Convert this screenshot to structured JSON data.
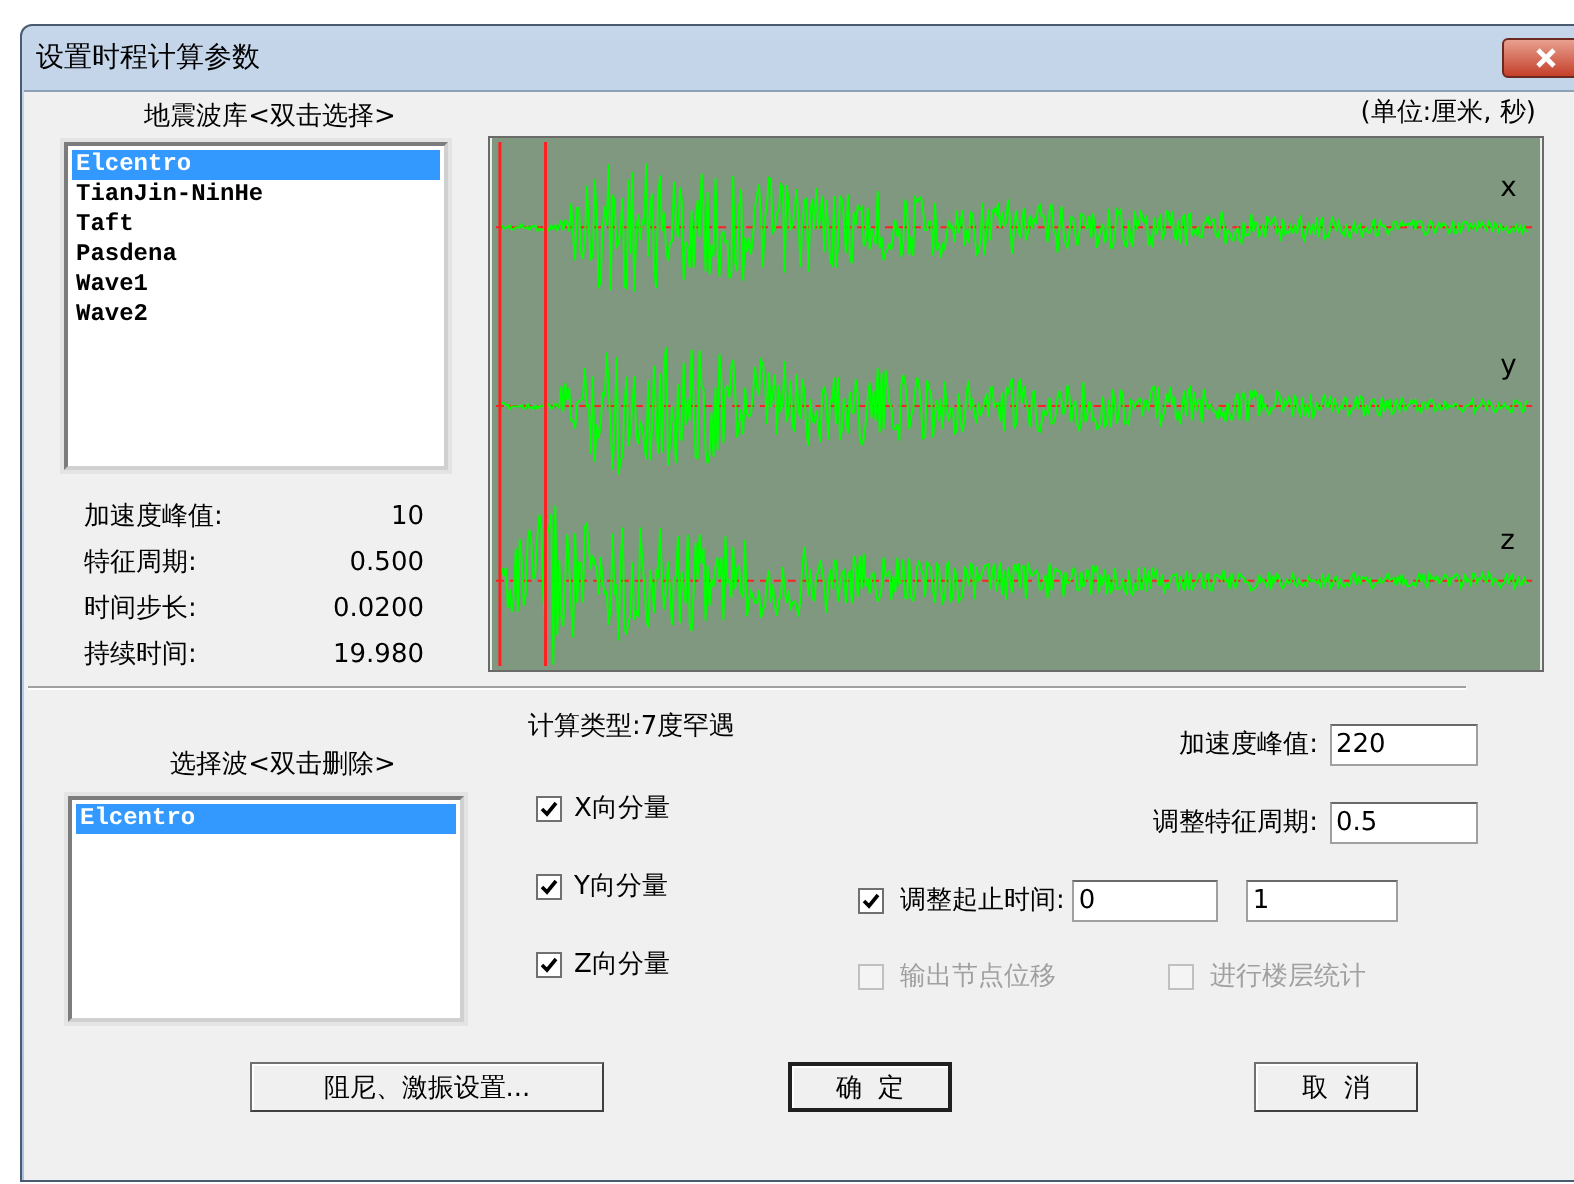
{
  "window": {
    "title": "设置时程计算参数"
  },
  "library": {
    "title": "地震波库<双击选择>",
    "items": [
      {
        "label": "Elcentro",
        "selected": true
      },
      {
        "label": "TianJin-NinHe",
        "selected": false
      },
      {
        "label": "Taft",
        "selected": false
      },
      {
        "label": "Pasdena",
        "selected": false
      },
      {
        "label": "Wave1",
        "selected": false
      },
      {
        "label": "Wave2",
        "selected": false
      }
    ]
  },
  "wave_info": [
    {
      "label": "加速度峰值:",
      "value": "10"
    },
    {
      "label": "特征周期:",
      "value": "0.500"
    },
    {
      "label": "时间步长:",
      "value": "0.0200"
    },
    {
      "label": "持续时间:",
      "value": "19.980"
    }
  ],
  "units": "(单位:厘米, 秒)",
  "plot": {
    "traces": [
      {
        "label": "x"
      },
      {
        "label": "y"
      },
      {
        "label": "z"
      }
    ]
  },
  "selected_waves": {
    "title": "选择波<双击删除>",
    "items": [
      {
        "label": "Elcentro",
        "selected": true
      }
    ]
  },
  "calc_type": "计算类型:7度罕遇",
  "components": [
    {
      "label": "X向分量",
      "checked": true
    },
    {
      "label": "Y向分量",
      "checked": true
    },
    {
      "label": "Z向分量",
      "checked": true
    }
  ],
  "peak_accel": {
    "label": "加速度峰值:",
    "value": "220"
  },
  "period": {
    "label": "调整特征周期:",
    "value": "0.5"
  },
  "time_range": {
    "label": "调整起止时间:",
    "checked": true,
    "start": "0",
    "end": "1"
  },
  "options": [
    {
      "label": "输出节点位移",
      "checked": false,
      "disabled": true
    },
    {
      "label": "进行楼层统计",
      "checked": false,
      "disabled": true
    }
  ],
  "buttons": [
    {
      "label": "阻尼、激振设置..."
    },
    {
      "label": "确  定"
    },
    {
      "label": "取  消"
    }
  ]
}
